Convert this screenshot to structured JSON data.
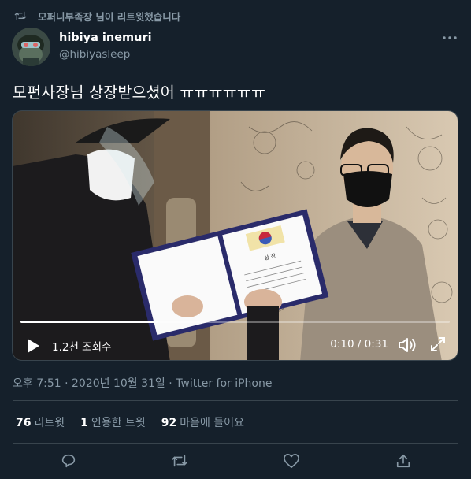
{
  "retweet_banner": {
    "text": "모퍼니부족장 님이 리트윗했습니다",
    "icon": "retweet-icon"
  },
  "author": {
    "display_name": "hibiya inemuri",
    "handle": "@hibiyasleep"
  },
  "tweet": {
    "text": "모펀사장님 상장받으셨어 ㅠㅠㅠㅠㅠㅠ"
  },
  "video": {
    "views_label": "1.2천 조회수",
    "time_label": "0:10 / 0:31",
    "progress": 0.32,
    "icons": [
      "play-icon",
      "volume-icon",
      "fullscreen-icon"
    ],
    "certificate_title": "상 장"
  },
  "meta": {
    "timestamp_source": "오후 7:51 · 2020년 10월 31일 · Twitter for iPhone"
  },
  "stats": [
    {
      "count": "76",
      "label": "리트윗"
    },
    {
      "count": "1",
      "label": "인용한 트윗"
    },
    {
      "count": "92",
      "label": "마음에 들어요"
    }
  ],
  "colors": {
    "background": "#15202b",
    "secondary_text": "#8899a6",
    "divider": "#38444d"
  }
}
